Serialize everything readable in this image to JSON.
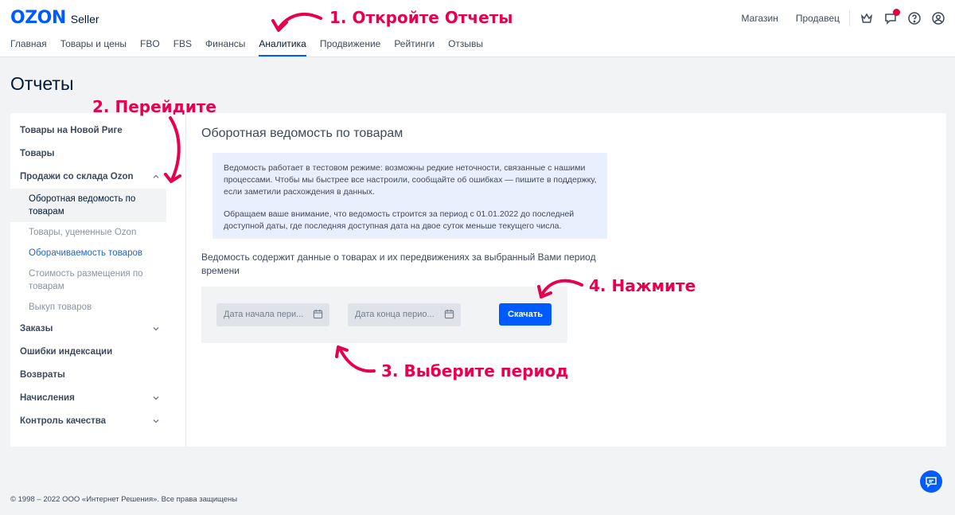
{
  "header": {
    "logo_text": "OZON",
    "logo_sub": "Seller",
    "nav": [
      "Главная",
      "Товары и цены",
      "FBO",
      "FBS",
      "Финансы",
      "Аналитика",
      "Продвижение",
      "Рейтинги",
      "Отзывы"
    ],
    "active_nav": "Аналитика",
    "right_links": [
      "Магазин",
      "Продавец"
    ],
    "icons": [
      "crown-icon",
      "chat-icon",
      "help-icon",
      "user-icon"
    ]
  },
  "page": {
    "title": "Отчеты"
  },
  "sidebar": {
    "items": [
      {
        "label": "Товары на Новой Риге"
      },
      {
        "label": "Товары"
      },
      {
        "label": "Продажи со склада Ozon",
        "expanded": true
      }
    ],
    "sub_items": [
      {
        "label": "Оборотная ведомость по товарам",
        "state": "selected"
      },
      {
        "label": "Товары, уцененные Ozon",
        "state": "normal"
      },
      {
        "label": "Оборачиваемость товаров",
        "state": "link"
      },
      {
        "label": "Стоимость размещения по товарам",
        "state": "normal"
      },
      {
        "label": "Выкуп товаров",
        "state": "normal"
      }
    ],
    "items_after": [
      {
        "label": "Заказы",
        "chevron": true
      },
      {
        "label": "Ошибки индексации"
      },
      {
        "label": "Возвраты"
      },
      {
        "label": "Начисления",
        "chevron": true
      },
      {
        "label": "Контроль качества",
        "chevron": true
      }
    ]
  },
  "main": {
    "title": "Оборотная ведомость по товарам",
    "notice_p1": "Ведомость работает в тестовом режиме: возможны редкие неточности, связанные с нашими процессами. Чтобы мы быстрее все настроили, сообщайте об ошибках — пишите в поддержку, если заметили расхождения в данных.",
    "notice_p2": "Обращаем ваше внимание, что ведомость строится за период с 01.01.2022 до последней доступной даты, где последняя доступная дата на двое суток меньше текущего числа.",
    "description": "Ведомость содержит данные о товарах и их передвижениях за выбранный Вами период времени",
    "start_placeholder": "Дата начала пери...",
    "end_placeholder": "Дата конца перио...",
    "download_label": "Скачать"
  },
  "annotations": {
    "step1": "1. Откройте Отчеты",
    "step2": "2. Перейдите",
    "step3": "3. Выберите период",
    "step4": "4. Нажмите"
  },
  "footer": {
    "copyright": "© 1998 – 2022 ООО «Интернет Решения». Все права защищены"
  },
  "colors": {
    "accent": "#005bff",
    "annotation": "#e6004f",
    "badge": "#e3003d"
  }
}
